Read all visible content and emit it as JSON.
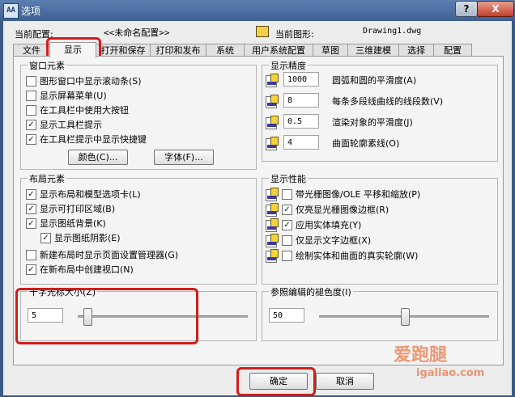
{
  "window": {
    "title": "选项",
    "app_icon_text": "AA",
    "help_label": "?",
    "close_label": "X"
  },
  "header": {
    "profile_label": "当前配置:",
    "profile_value": "<<未命名配置>>",
    "drawing_label": "当前图形:",
    "drawing_value": "Drawing1.dwg"
  },
  "tabs": [
    {
      "label": "文件"
    },
    {
      "label": "显示",
      "active": true
    },
    {
      "label": "打开和保存"
    },
    {
      "label": "打印和发布"
    },
    {
      "label": "系统"
    },
    {
      "label": "用户系统配置"
    },
    {
      "label": "草图"
    },
    {
      "label": "三维建模"
    },
    {
      "label": "选择"
    },
    {
      "label": "配置"
    }
  ],
  "window_elements": {
    "title": "窗口元素",
    "items": [
      {
        "label": "图形窗口中显示滚动条(S)",
        "checked": false
      },
      {
        "label": "显示屏幕菜单(U)",
        "checked": false
      },
      {
        "label": "在工具栏中使用大按钮",
        "checked": false
      },
      {
        "label": "显示工具栏提示",
        "checked": true
      },
      {
        "label": "在工具栏提示中显示快捷键",
        "checked": true
      }
    ],
    "colors_button": "颜色(C)...",
    "fonts_button": "字体(F)..."
  },
  "display_resolution": {
    "title": "显示精度",
    "items": [
      {
        "value": "1000",
        "label": "圆弧和圆的平滑度(A)"
      },
      {
        "value": "8",
        "label": "每条多段线曲线的线段数(V)"
      },
      {
        "value": "0.5",
        "label": "渲染对象的平滑度(J)"
      },
      {
        "value": "4",
        "label": "曲面轮廓素线(O)"
      }
    ]
  },
  "layout_elements": {
    "title": "布局元素",
    "items": [
      {
        "label": "显示布局和模型选项卡(L)",
        "checked": true
      },
      {
        "label": "显示可打印区域(B)",
        "checked": true
      },
      {
        "label": "显示图纸背景(K)",
        "checked": true
      },
      {
        "label": "显示图纸阴影(E)",
        "checked": true
      },
      {
        "label": "新建布局时显示页面设置管理器(G)",
        "checked": false
      },
      {
        "label": "在新布局中创建视口(N)",
        "checked": true
      }
    ]
  },
  "display_performance": {
    "title": "显示性能",
    "items": [
      {
        "label": "带光栅图像/OLE 平移和缩放(P)",
        "checked": false
      },
      {
        "label": "仅亮显光栅图像边框(R)",
        "checked": true
      },
      {
        "label": "应用实体填充(Y)",
        "checked": true
      },
      {
        "label": "仅显示文字边框(X)",
        "checked": false
      },
      {
        "label": "绘制实体和曲面的真实轮廓(W)",
        "checked": false
      }
    ]
  },
  "crosshair": {
    "title": "十字光标大小(Z)",
    "value": "5",
    "slider_fraction": 0.05
  },
  "xref_fading": {
    "title": "参照编辑的褪色度(I)",
    "value": "50",
    "slider_fraction": 0.5
  },
  "footer": {
    "ok_button": "确定",
    "cancel_button": "取消"
  },
  "watermark": {
    "text": "爱跑腿",
    "url": "igaliao.com"
  },
  "colors": {
    "highlight": "#d11c1c",
    "title_bar": "#3e5f92",
    "close_button": "#c2402b"
  }
}
